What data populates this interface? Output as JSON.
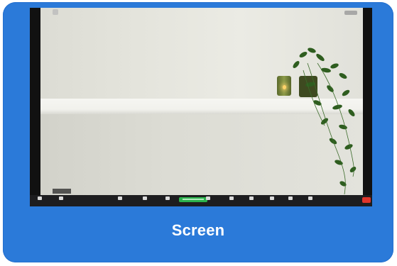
{
  "caption": "Screen",
  "colors": {
    "card": "#2b7ad9",
    "toolbar": "#1d1d1f",
    "share": "#2bb24c",
    "end": "#e0352b"
  },
  "toolbar": {
    "items": [
      {
        "name": "mute-icon"
      },
      {
        "name": "video-icon"
      },
      {
        "name": "security-icon"
      },
      {
        "name": "participants-icon"
      },
      {
        "name": "chat-icon"
      },
      {
        "name": "share-screen-icon"
      },
      {
        "name": "record-icon"
      },
      {
        "name": "closed-caption-icon"
      },
      {
        "name": "breakout-rooms-icon"
      },
      {
        "name": "reactions-icon"
      },
      {
        "name": "apps-icon"
      },
      {
        "name": "more-icon"
      }
    ]
  }
}
